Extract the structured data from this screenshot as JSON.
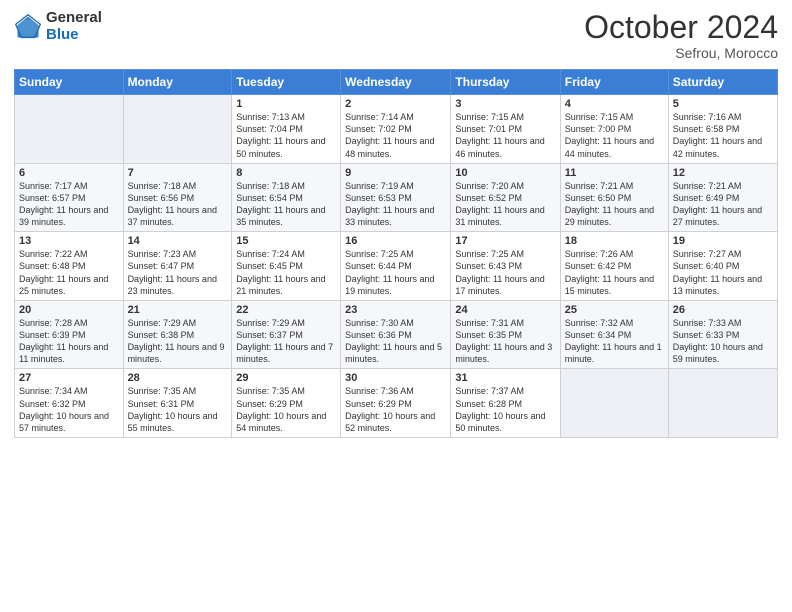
{
  "header": {
    "logo_general": "General",
    "logo_blue": "Blue",
    "month_title": "October 2024",
    "location": "Sefrou, Morocco"
  },
  "weekdays": [
    "Sunday",
    "Monday",
    "Tuesday",
    "Wednesday",
    "Thursday",
    "Friday",
    "Saturday"
  ],
  "weeks": [
    [
      {
        "day": "",
        "info": ""
      },
      {
        "day": "",
        "info": ""
      },
      {
        "day": "1",
        "info": "Sunrise: 7:13 AM\nSunset: 7:04 PM\nDaylight: 11 hours and 50 minutes."
      },
      {
        "day": "2",
        "info": "Sunrise: 7:14 AM\nSunset: 7:02 PM\nDaylight: 11 hours and 48 minutes."
      },
      {
        "day": "3",
        "info": "Sunrise: 7:15 AM\nSunset: 7:01 PM\nDaylight: 11 hours and 46 minutes."
      },
      {
        "day": "4",
        "info": "Sunrise: 7:15 AM\nSunset: 7:00 PM\nDaylight: 11 hours and 44 minutes."
      },
      {
        "day": "5",
        "info": "Sunrise: 7:16 AM\nSunset: 6:58 PM\nDaylight: 11 hours and 42 minutes."
      }
    ],
    [
      {
        "day": "6",
        "info": "Sunrise: 7:17 AM\nSunset: 6:57 PM\nDaylight: 11 hours and 39 minutes."
      },
      {
        "day": "7",
        "info": "Sunrise: 7:18 AM\nSunset: 6:56 PM\nDaylight: 11 hours and 37 minutes."
      },
      {
        "day": "8",
        "info": "Sunrise: 7:18 AM\nSunset: 6:54 PM\nDaylight: 11 hours and 35 minutes."
      },
      {
        "day": "9",
        "info": "Sunrise: 7:19 AM\nSunset: 6:53 PM\nDaylight: 11 hours and 33 minutes."
      },
      {
        "day": "10",
        "info": "Sunrise: 7:20 AM\nSunset: 6:52 PM\nDaylight: 11 hours and 31 minutes."
      },
      {
        "day": "11",
        "info": "Sunrise: 7:21 AM\nSunset: 6:50 PM\nDaylight: 11 hours and 29 minutes."
      },
      {
        "day": "12",
        "info": "Sunrise: 7:21 AM\nSunset: 6:49 PM\nDaylight: 11 hours and 27 minutes."
      }
    ],
    [
      {
        "day": "13",
        "info": "Sunrise: 7:22 AM\nSunset: 6:48 PM\nDaylight: 11 hours and 25 minutes."
      },
      {
        "day": "14",
        "info": "Sunrise: 7:23 AM\nSunset: 6:47 PM\nDaylight: 11 hours and 23 minutes."
      },
      {
        "day": "15",
        "info": "Sunrise: 7:24 AM\nSunset: 6:45 PM\nDaylight: 11 hours and 21 minutes."
      },
      {
        "day": "16",
        "info": "Sunrise: 7:25 AM\nSunset: 6:44 PM\nDaylight: 11 hours and 19 minutes."
      },
      {
        "day": "17",
        "info": "Sunrise: 7:25 AM\nSunset: 6:43 PM\nDaylight: 11 hours and 17 minutes."
      },
      {
        "day": "18",
        "info": "Sunrise: 7:26 AM\nSunset: 6:42 PM\nDaylight: 11 hours and 15 minutes."
      },
      {
        "day": "19",
        "info": "Sunrise: 7:27 AM\nSunset: 6:40 PM\nDaylight: 11 hours and 13 minutes."
      }
    ],
    [
      {
        "day": "20",
        "info": "Sunrise: 7:28 AM\nSunset: 6:39 PM\nDaylight: 11 hours and 11 minutes."
      },
      {
        "day": "21",
        "info": "Sunrise: 7:29 AM\nSunset: 6:38 PM\nDaylight: 11 hours and 9 minutes."
      },
      {
        "day": "22",
        "info": "Sunrise: 7:29 AM\nSunset: 6:37 PM\nDaylight: 11 hours and 7 minutes."
      },
      {
        "day": "23",
        "info": "Sunrise: 7:30 AM\nSunset: 6:36 PM\nDaylight: 11 hours and 5 minutes."
      },
      {
        "day": "24",
        "info": "Sunrise: 7:31 AM\nSunset: 6:35 PM\nDaylight: 11 hours and 3 minutes."
      },
      {
        "day": "25",
        "info": "Sunrise: 7:32 AM\nSunset: 6:34 PM\nDaylight: 11 hours and 1 minute."
      },
      {
        "day": "26",
        "info": "Sunrise: 7:33 AM\nSunset: 6:33 PM\nDaylight: 10 hours and 59 minutes."
      }
    ],
    [
      {
        "day": "27",
        "info": "Sunrise: 7:34 AM\nSunset: 6:32 PM\nDaylight: 10 hours and 57 minutes."
      },
      {
        "day": "28",
        "info": "Sunrise: 7:35 AM\nSunset: 6:31 PM\nDaylight: 10 hours and 55 minutes."
      },
      {
        "day": "29",
        "info": "Sunrise: 7:35 AM\nSunset: 6:29 PM\nDaylight: 10 hours and 54 minutes."
      },
      {
        "day": "30",
        "info": "Sunrise: 7:36 AM\nSunset: 6:29 PM\nDaylight: 10 hours and 52 minutes."
      },
      {
        "day": "31",
        "info": "Sunrise: 7:37 AM\nSunset: 6:28 PM\nDaylight: 10 hours and 50 minutes."
      },
      {
        "day": "",
        "info": ""
      },
      {
        "day": "",
        "info": ""
      }
    ]
  ]
}
